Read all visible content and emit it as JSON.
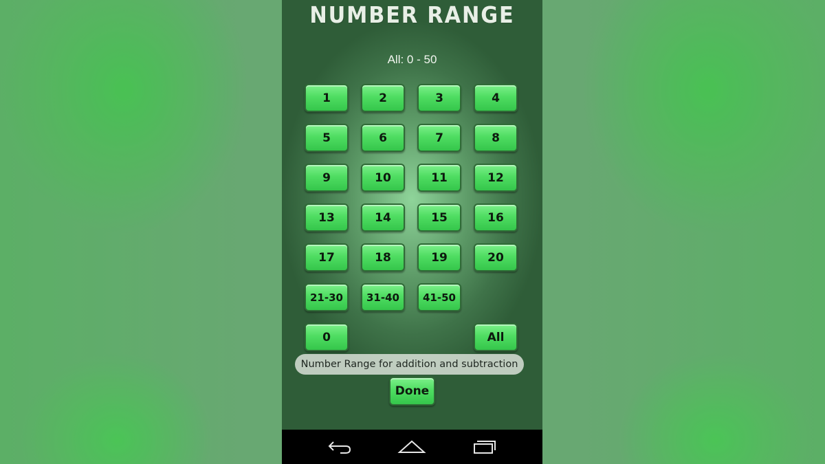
{
  "title": "NUMBER RANGE",
  "range_label": "All: 0 - 50",
  "buttons": {
    "b1": "1",
    "b2": "2",
    "b3": "3",
    "b4": "4",
    "b5": "5",
    "b6": "6",
    "b7": "7",
    "b8": "8",
    "b9": "9",
    "b10": "10",
    "b11": "11",
    "b12": "12",
    "b13": "13",
    "b14": "14",
    "b15": "15",
    "b16": "16",
    "b17": "17",
    "b18": "18",
    "b19": "19",
    "b20": "20",
    "b21_30": "21-30",
    "b31_40": "31-40",
    "b41_50": "41-50",
    "b0": "0",
    "ball": "All"
  },
  "caption": "Number Range for addition and subtraction",
  "done_label": "Done",
  "nav": {
    "back_icon": "back-arrow",
    "home_icon": "home",
    "recents_icon": "recent-apps"
  },
  "colors": {
    "button_green": "#4fdd62",
    "button_border": "#2f6a36",
    "board": "#5c9966"
  }
}
